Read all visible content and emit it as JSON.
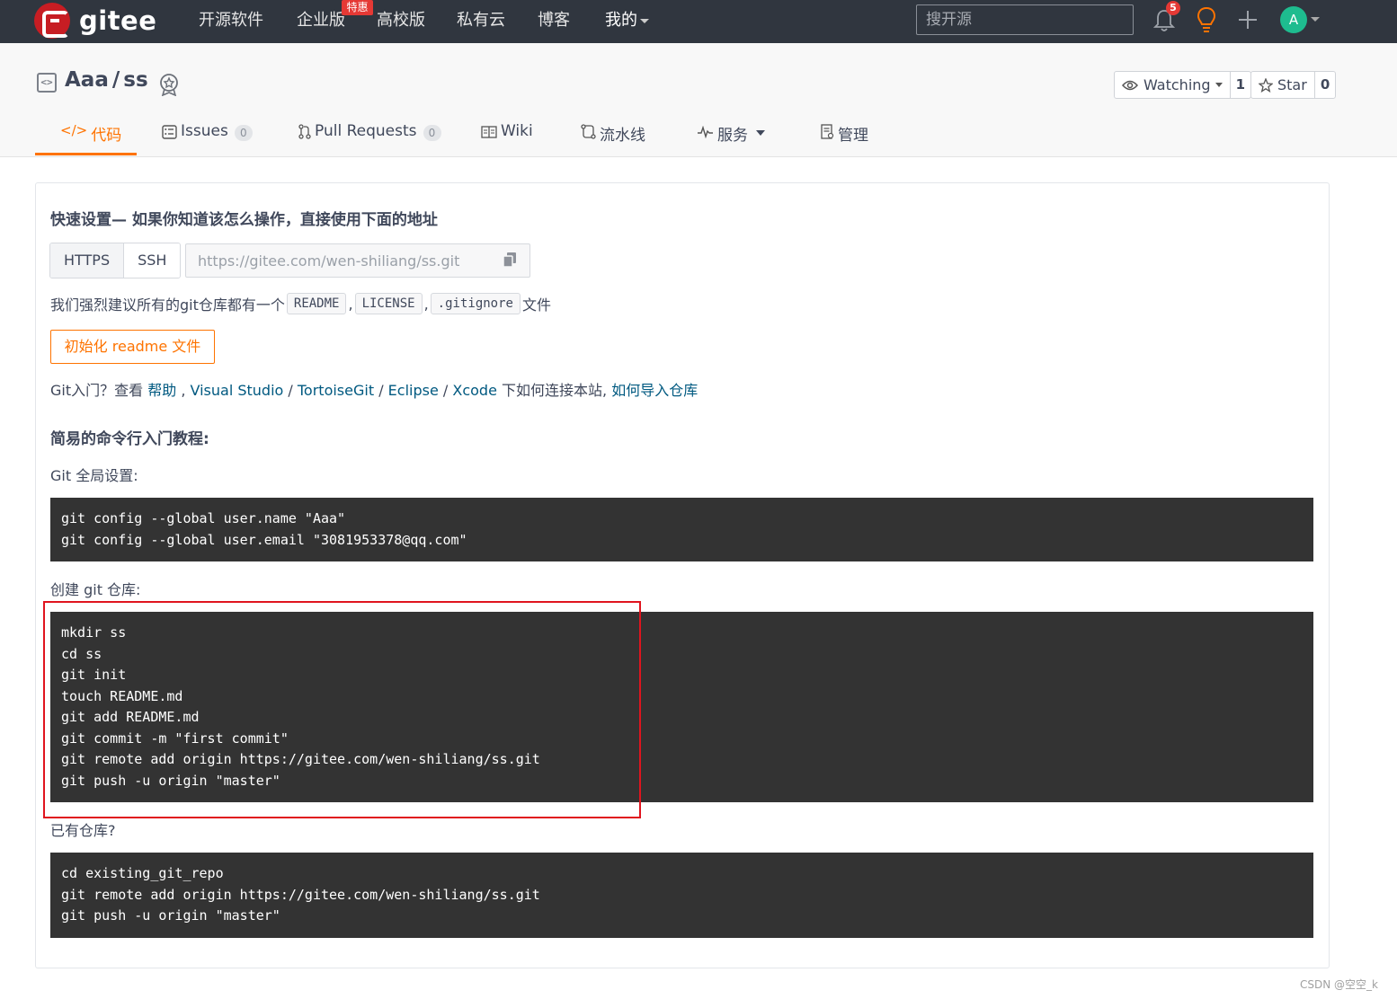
{
  "navbar": {
    "brand": "gitee",
    "items": [
      "开源软件",
      "企业版",
      "高校版",
      "私有云",
      "博客",
      "我的"
    ],
    "promo_badge": "特惠",
    "search_placeholder": "搜开源",
    "notification_count": "5",
    "avatar_initial": "A",
    "bg_color": "#30363f"
  },
  "repo": {
    "owner": "Aaa",
    "separator": "/",
    "name": "ss",
    "watching_label": "Watching",
    "watching_count": "1",
    "star_label": "Star",
    "star_count": "0"
  },
  "tabs": [
    {
      "label": "代码",
      "icon": "code-icon",
      "active": true
    },
    {
      "label": "Issues",
      "icon": "issues-icon",
      "count": "0"
    },
    {
      "label": "Pull Requests",
      "icon": "pull-request-icon",
      "count": "0"
    },
    {
      "label": "Wiki",
      "icon": "wiki-icon"
    },
    {
      "label": "流水线",
      "icon": "pipeline-icon"
    },
    {
      "label": "服务",
      "icon": "service-icon"
    },
    {
      "label": "管理",
      "icon": "settings-icon"
    }
  ],
  "quick_setup": {
    "title": "快速设置— 如果你知道该怎么操作，直接使用下面的地址",
    "protocols": [
      "HTTPS",
      "SSH"
    ],
    "url": "https://gitee.com/wen-shiliang/ss.git",
    "suggest_prefix": "我们强烈建议所有的git仓库都有一个",
    "suggest_files": [
      "README",
      "LICENSE",
      ".gitignore"
    ],
    "suggest_sep": ",",
    "suggest_suffix": "文件",
    "init_button": "初始化 readme 文件",
    "git_intro_prefix": "Git入门？查看 ",
    "git_intro_links": [
      "帮助",
      "Visual Studio",
      "TortoiseGit",
      "Eclipse",
      "Xcode"
    ],
    "git_intro_mid": " 下如何连接本站, ",
    "git_intro_last_link": "如何导入仓库"
  },
  "tutorial": {
    "title": "简易的命令行入门教程:",
    "global_label": "Git 全局设置:",
    "global_code": "git config --global user.name \"Aaa\"\ngit config --global user.email \"3081953378@qq.com\"",
    "create_label": "创建 git 仓库:",
    "create_code": "mkdir ss\ncd ss\ngit init\ntouch README.md\ngit add README.md\ngit commit -m \"first commit\"\ngit remote add origin https://gitee.com/wen-shiliang/ss.git\ngit push -u origin \"master\"",
    "existing_label": "已有仓库?",
    "existing_code": "cd existing_git_repo\ngit remote add origin https://gitee.com/wen-shiliang/ss.git\ngit push -u origin \"master\""
  },
  "watermark": "CSDN @空空_k",
  "colors": {
    "accent": "#fe7300",
    "link": "#005980",
    "code_bg": "#333333",
    "annotation": "#e0141e"
  }
}
